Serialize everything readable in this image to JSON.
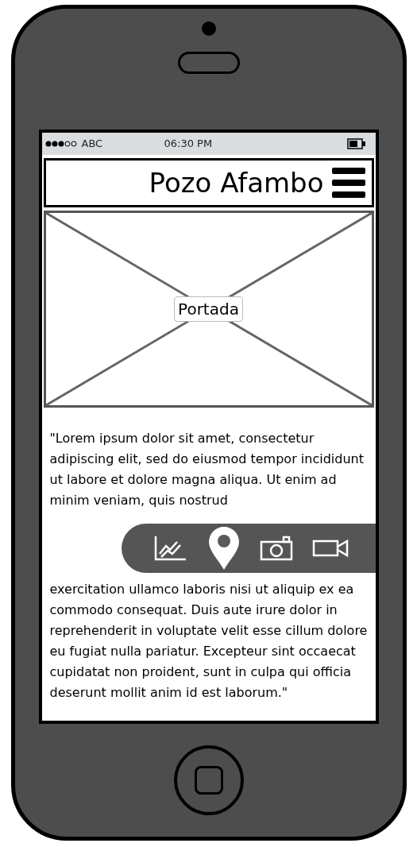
{
  "status_bar": {
    "carrier": "ABC",
    "time": "06:30 PM"
  },
  "header": {
    "title": "Pozo Afambo"
  },
  "cover": {
    "label": "Portada"
  },
  "body": {
    "parts": [
      "\"Lorem ipsum dolor sit amet, consectetur adipiscing elit, sed do eiusmod tempor incididunt ut labore et dolore magna aliqua. Ut enim ad minim veniam, quis nostrud",
      "exercitation ullamco laboris nisi ut aliquip ex ea commodo consequat. Duis aute irure dolor in reprehenderit in voluptate velit esse cillum dolore eu fugiat nulla pariatur. Excepteur sint occaecat cupidatat non proident, sunt in culpa qui officia deserunt mollit anim id est laborum.\""
    ]
  },
  "toolbar": {
    "items": [
      {
        "kind": "chart"
      },
      {
        "kind": "pin"
      },
      {
        "kind": "camera"
      },
      {
        "kind": "video"
      }
    ]
  }
}
